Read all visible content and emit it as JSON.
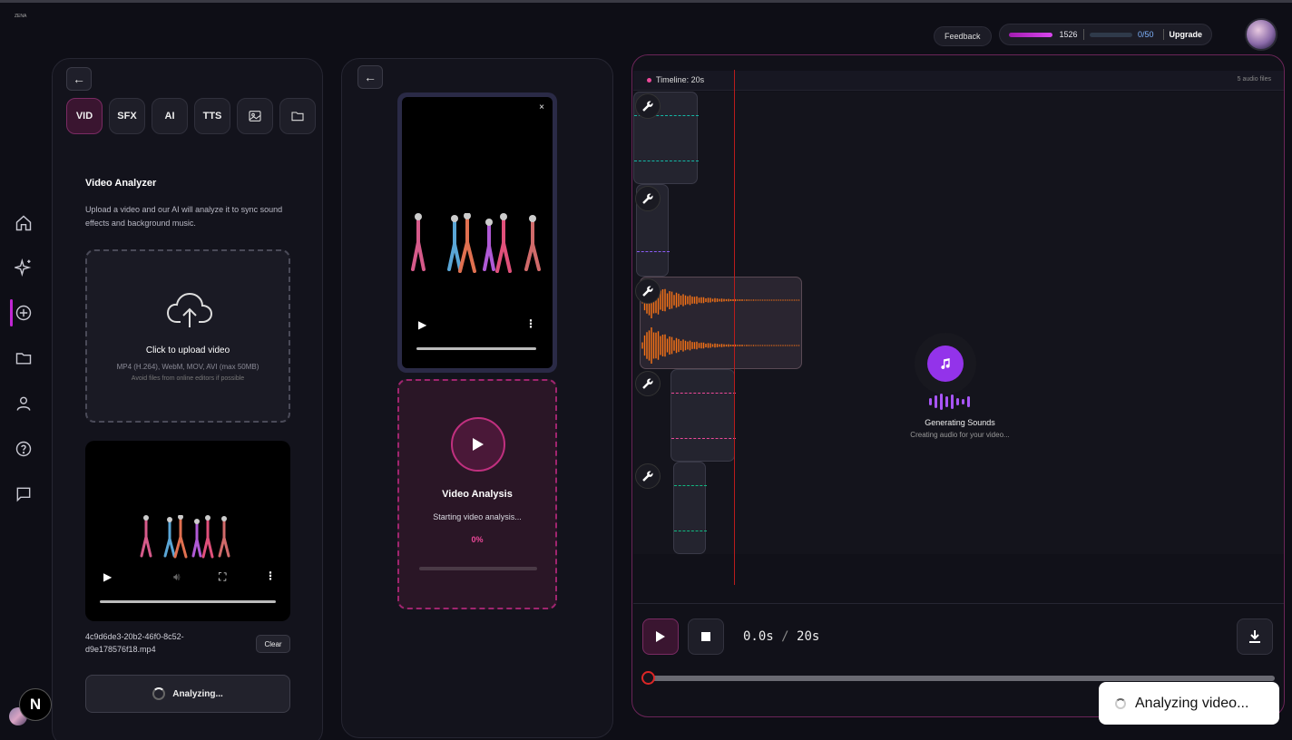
{
  "brand": "ZENA",
  "topbar": {
    "feedback_label": "Feedback",
    "credits_value": "1526",
    "quota": "0/50",
    "upgrade_label": "Upgrade"
  },
  "nav": {
    "items": [
      "home-icon",
      "sparkles-icon",
      "plus-circle-icon",
      "folder-icon",
      "user-icon",
      "help-icon",
      "chat-icon"
    ],
    "badge": "N"
  },
  "tools": [
    "VID",
    "SFX",
    "AI",
    "TTS"
  ],
  "analyzer": {
    "title": "Video Analyzer",
    "description": "Upload a video and our AI will analyze it to sync sound effects and background music.",
    "upload_main": "Click to upload video",
    "upload_formats": "MP4 (H.264), WebM, MOV, AVI (max 50MB)",
    "upload_hint": "Avoid files from online editors if possible",
    "filename": "4c9d6de3-20b2-46f0-8c52-d9e178576f18.mp4",
    "clear_label": "Clear",
    "analyze_label": "Analyzing..."
  },
  "preview": {
    "close_label": "×",
    "analysis_title": "Video Analysis",
    "analysis_status": "Starting video analysis...",
    "analysis_pct": "0%",
    "analysis_progress": 0
  },
  "timeline": {
    "label": "Timeline: 20s",
    "file_count": "5 audio files",
    "generating_title": "Generating Sounds",
    "generating_sub": "Creating audio for your video...",
    "current_time": "0.0s",
    "divider": "/",
    "total_time": "20s",
    "colors": {
      "teal": "#14b8a6",
      "purple": "#8b5cf6",
      "orange": "#f97316",
      "pink": "#ec4899",
      "green": "#10b981"
    }
  },
  "toast": {
    "message": "Analyzing video..."
  }
}
